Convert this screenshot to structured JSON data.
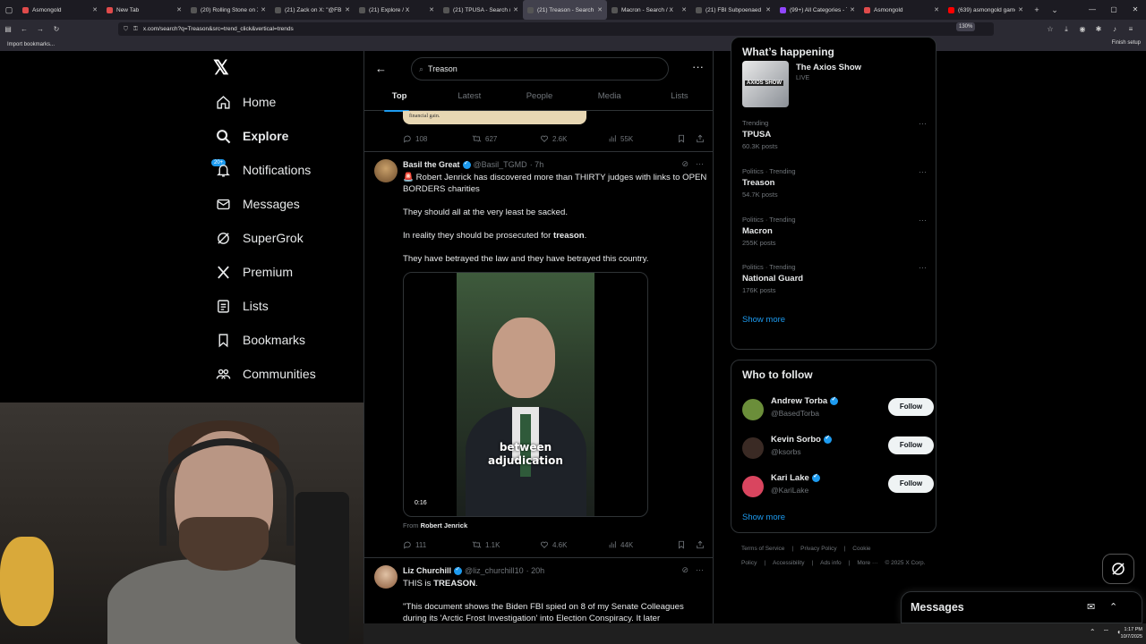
{
  "browser": {
    "tabs": [
      {
        "label": "Asmongold",
        "color": "#e04b4b",
        "active": false
      },
      {
        "label": "New Tab",
        "color": "#e04b4b",
        "active": false
      },
      {
        "label": "(20) Rolling Stone on X:",
        "color": "#555555",
        "active": false
      },
      {
        "label": "(21) Zack on X: \"@FBIDi",
        "color": "#555555",
        "active": false
      },
      {
        "label": "(21) Explore / X",
        "color": "#555555",
        "active": false
      },
      {
        "label": "(21) TPUSA - Search / X",
        "color": "#555555",
        "active": false
      },
      {
        "label": "(21) Treason - Search / X",
        "color": "#555555",
        "active": true
      },
      {
        "label": "Macron - Search / X",
        "color": "#555555",
        "active": false
      },
      {
        "label": "(21) FBI Subpoenaed Eig",
        "color": "#555555",
        "active": false
      },
      {
        "label": "(99+) All Categories - Tw",
        "color": "#9146ff",
        "active": false
      },
      {
        "label": "Asmongold",
        "color": "#e04b4b",
        "active": false
      },
      {
        "label": "(639) asmongold gamer",
        "color": "#ff0000",
        "active": false
      }
    ],
    "url": "x.com/search?q=Treason&src=trend_click&vertical=trends",
    "zoom": "130%",
    "bookmark": "Import bookmarks...",
    "finish_setup": "Finish setup"
  },
  "nav": {
    "items": [
      {
        "label": "Home",
        "icon": "home-icon"
      },
      {
        "label": "Explore",
        "icon": "search-icon"
      },
      {
        "label": "Notifications",
        "icon": "bell-icon"
      },
      {
        "label": "Messages",
        "icon": "mail-icon"
      },
      {
        "label": "SuperGrok",
        "icon": "grok-icon"
      },
      {
        "label": "Premium",
        "icon": "x-icon"
      },
      {
        "label": "Lists",
        "icon": "list-icon"
      },
      {
        "label": "Bookmarks",
        "icon": "bookmark-icon"
      },
      {
        "label": "Communities",
        "icon": "people-icon"
      }
    ],
    "notif_badge": "20+"
  },
  "search": {
    "query": "Treason",
    "tabs": [
      "Top",
      "Latest",
      "People",
      "Media",
      "Lists"
    ]
  },
  "prev_tweet": {
    "card_text": "financial gain.",
    "replies": "108",
    "reposts": "627",
    "likes": "2.6K",
    "views": "55K"
  },
  "tweet1": {
    "name": "Basil the Great",
    "handle": "@Basil_TGMD",
    "time": "· 7h",
    "line1": "🚨 Robert Jenrick has discovered more than THIRTY judges with links to OPEN BORDERS charities",
    "line2": "They should all at the very least be sacked.",
    "line3_pre": "In reality they should be prosecuted for ",
    "line3_bold": "treason",
    "line3_post": ".",
    "line4": "They have betrayed the law and they have betrayed this country.",
    "video_caption_1": "between",
    "video_caption_2": "adjudication",
    "video_time": "0:16",
    "from_pre": "From ",
    "from_name": "Robert Jenrick",
    "replies": "111",
    "reposts": "1.1K",
    "likes": "4.6K",
    "views": "44K"
  },
  "tweet2": {
    "name": "Liz Churchill",
    "handle": "@liz_churchill10",
    "time": "· 20h",
    "line1_pre": "THIS is ",
    "line1_bold": "TREASON",
    "line1_post": ".",
    "line2": "\"This document shows the Biden FBI spied on 8 of my Senate Colleagues during its 'Arctic Frost Investigation' into Election Conspiracy. It later"
  },
  "right": {
    "happening_title": "What’s happening",
    "show_title": "The Axios Show",
    "show_status": "LIVE",
    "show_thumb_text": "AXIOS SHOW",
    "trends": [
      {
        "category": "Trending",
        "title": "TPUSA",
        "posts": "60.3K posts"
      },
      {
        "category": "Politics · Trending",
        "title": "Treason",
        "posts": "54.7K posts"
      },
      {
        "category": "Politics · Trending",
        "title": "Macron",
        "posts": "255K posts"
      },
      {
        "category": "Politics · Trending",
        "title": "National Guard",
        "posts": "176K posts"
      }
    ],
    "show_more": "Show more",
    "wtf_title": "Who to follow",
    "follows": [
      {
        "name": "Andrew Torba",
        "handle": "@BasedTorba",
        "button": "Follow",
        "color": "#6b8e3a"
      },
      {
        "name": "Kevin Sorbo",
        "handle": "@ksorbs",
        "button": "Follow",
        "color": "#3a2a24"
      },
      {
        "name": "Kari Lake",
        "handle": "@KariLake",
        "button": "Follow",
        "color": "#d9455f"
      }
    ],
    "show_more_2": "Show more",
    "footer": [
      "Terms of Service",
      "|",
      "Privacy Policy",
      "|",
      "Cookie Policy",
      "|",
      "Accessibility",
      "|",
      "Ads info",
      "|",
      "More ···",
      "© 2025 X Corp."
    ]
  },
  "messages_label": "Messages",
  "taskbar": {
    "time": "1:17 PM",
    "date": "10/7/2025"
  }
}
